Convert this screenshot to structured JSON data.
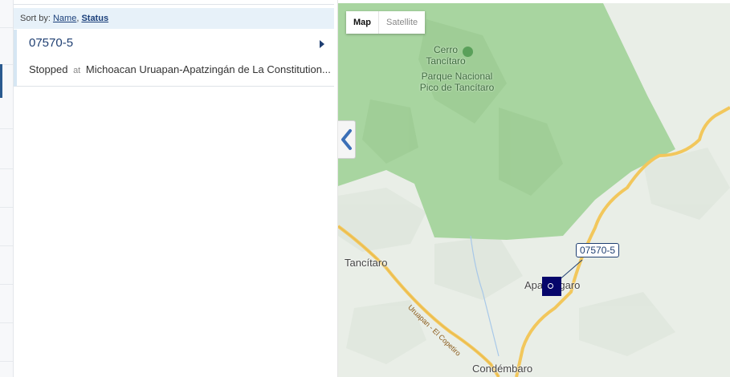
{
  "sort_bar": {
    "prefix": "Sort by:",
    "options": [
      "Name",
      "Status"
    ],
    "separator": ","
  },
  "units": [
    {
      "name": "07570-5",
      "status": "Stopped",
      "at": "at",
      "location": "Michoacan Uruapan-Apatzingán de La Constitution..."
    }
  ],
  "map": {
    "type_buttons": [
      "Map",
      "Satellite"
    ],
    "selected_type": "Map",
    "places": [
      "Cerro Tancítaro",
      "Parque Nacional Pico de Tancítaro",
      "Tancítaro",
      "Apatzingaro",
      "Condémbaro"
    ],
    "road": "Uruapan - El Copetiro",
    "callout": "07570-5",
    "colors": {
      "park": "#a8d5a0",
      "road": "#f2c75c",
      "marker": "#06066b",
      "accent": "#1f3f72"
    }
  }
}
